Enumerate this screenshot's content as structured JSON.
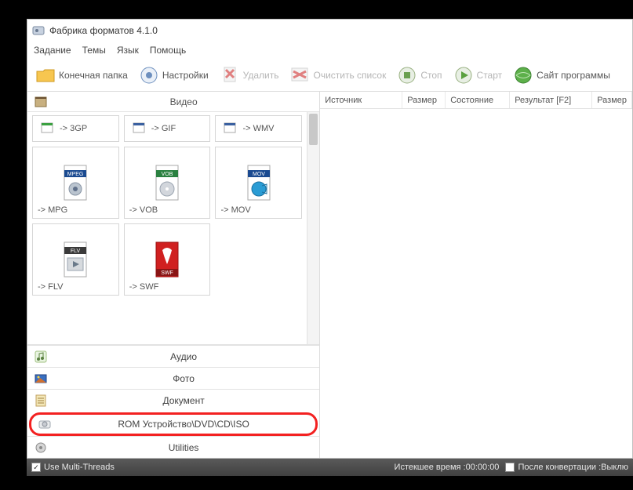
{
  "title": "Фабрика форматов 4.1.0",
  "menus": {
    "m0": "Задание",
    "m1": "Темы",
    "m2": "Язык",
    "m3": "Помощь"
  },
  "toolbar": {
    "dest": "Конечная папка",
    "settings": "Настройки",
    "delete": "Удалить",
    "clear": "Очистить список",
    "stop": "Стоп",
    "start": "Старт",
    "site": "Сайт программы"
  },
  "categories": {
    "video": "Видео",
    "audio": "Аудио",
    "photo": "Фото",
    "document": "Документ",
    "rom": "ROM Устройство\\DVD\\CD\\ISO",
    "utilities": "Utilities"
  },
  "formats": {
    "f0": "-> 3GP",
    "f1": "-> GIF",
    "f2": "-> WMV",
    "f3": "-> MPG",
    "f4": "-> VOB",
    "f5": "-> MOV",
    "f6": "-> FLV",
    "f7": "-> SWF"
  },
  "badges": {
    "b3": "MPEG",
    "b4": "VOB",
    "b5": "MOV",
    "b6": "FLV",
    "b7": "SWF"
  },
  "columns": {
    "c0": "Источник",
    "c1": "Размер",
    "c2": "Состояние",
    "c3": "Результат [F2]",
    "c4": "Размер"
  },
  "status": {
    "multithreads": "Use Multi-Threads",
    "elapsed_label": "Истекшее время : ",
    "elapsed_value": "00:00:00",
    "after_label": "После конвертации : ",
    "after_value": "Выклю"
  }
}
